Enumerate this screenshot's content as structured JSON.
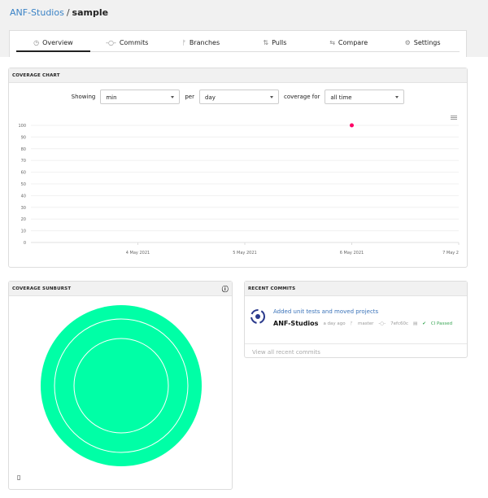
{
  "breadcrumb": {
    "org": "ANF-Studios",
    "separator": "/",
    "repo": "sample"
  },
  "tabs": [
    {
      "label": "Overview",
      "icon": "gauge-icon",
      "glyph": "◷",
      "active": true
    },
    {
      "label": "Commits",
      "icon": "commit-icon",
      "glyph": "-○-"
    },
    {
      "label": "Branches",
      "icon": "branch-icon",
      "glyph": "ᚠ"
    },
    {
      "label": "Pulls",
      "icon": "pull-request-icon",
      "glyph": "⇅"
    },
    {
      "label": "Compare",
      "icon": "compare-icon",
      "glyph": "⇆"
    },
    {
      "label": "Settings",
      "icon": "gear-icon",
      "glyph": "⚙"
    }
  ],
  "coverage_chart": {
    "title": "COVERAGE CHART",
    "showing_label": "Showing",
    "showing_value": "min",
    "per_label": "per",
    "per_value": "day",
    "coverage_for_label": "coverage for",
    "coverage_for_value": "all time"
  },
  "chart_data": {
    "type": "scatter",
    "x_ticks": [
      "4 May 2021",
      "5 May 2021",
      "6 May 2021",
      "7 May 2"
    ],
    "y_ticks": [
      0,
      10,
      20,
      30,
      40,
      50,
      60,
      70,
      80,
      90,
      100
    ],
    "ylim": [
      0,
      100
    ],
    "xlim": [
      "3 May 2021",
      "7 May 2021"
    ],
    "grid": true,
    "points": [
      {
        "x": "6 May 2021",
        "y": 100
      }
    ],
    "point_color": "#ff0066"
  },
  "sunburst": {
    "title": "COVERAGE SUNBURST",
    "color": "#00ffa6"
  },
  "recent_commits": {
    "title": "RECENT COMMITS",
    "commit": {
      "message": "Added unit tests and moved projects",
      "author": "ANF-Studios",
      "time": "a day ago",
      "branch": "master",
      "sha": "7efc60c",
      "ci": "CI Passed"
    },
    "view_all": "View all recent commits"
  }
}
